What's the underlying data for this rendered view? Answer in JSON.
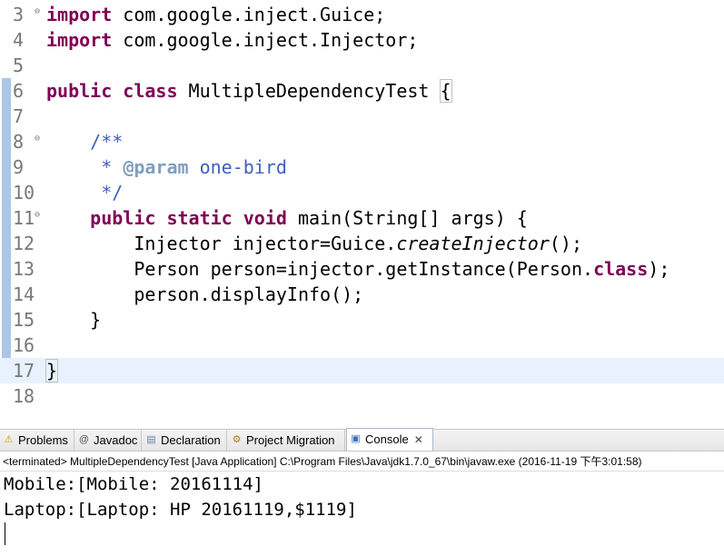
{
  "editor": {
    "lines": [
      {
        "num": "3",
        "fold": true,
        "parts": [
          {
            "t": "import",
            "c": "kw"
          },
          {
            "t": " com.google.inject.Guice;"
          }
        ]
      },
      {
        "num": "4",
        "parts": [
          {
            "t": "import",
            "c": "kw"
          },
          {
            "t": " com.google.inject.Injector;"
          }
        ]
      },
      {
        "num": "5",
        "parts": []
      },
      {
        "num": "6",
        "parts": [
          {
            "t": "public",
            "c": "kw"
          },
          {
            "t": " "
          },
          {
            "t": "class",
            "c": "kw"
          },
          {
            "t": " MultipleDependencyTest "
          },
          {
            "t": "{",
            "c": "brk"
          }
        ]
      },
      {
        "num": "7",
        "parts": []
      },
      {
        "num": "8",
        "fold": true,
        "parts": [
          {
            "t": "    "
          },
          {
            "t": "/**",
            "c": "jd"
          }
        ]
      },
      {
        "num": "9",
        "parts": [
          {
            "t": "     "
          },
          {
            "t": "* ",
            "c": "jd"
          },
          {
            "t": "@param",
            "c": "jdtag"
          },
          {
            "t": " one-bird",
            "c": "jd"
          }
        ]
      },
      {
        "num": "10",
        "parts": [
          {
            "t": "     "
          },
          {
            "t": "*/",
            "c": "jd"
          }
        ]
      },
      {
        "num": "11",
        "fold": true,
        "parts": [
          {
            "t": "    "
          },
          {
            "t": "public",
            "c": "kw"
          },
          {
            "t": " "
          },
          {
            "t": "static",
            "c": "kw"
          },
          {
            "t": " "
          },
          {
            "t": "void",
            "c": "kw"
          },
          {
            "t": " main(String[] args) {"
          }
        ]
      },
      {
        "num": "12",
        "parts": [
          {
            "t": "        Injector injector=Guice."
          },
          {
            "t": "createInjector",
            "c": "it"
          },
          {
            "t": "();"
          }
        ]
      },
      {
        "num": "13",
        "parts": [
          {
            "t": "        Person person=injector.getInstance(Person."
          },
          {
            "t": "class",
            "c": "kw"
          },
          {
            "t": ");"
          }
        ]
      },
      {
        "num": "14",
        "parts": [
          {
            "t": "        person.displayInfo();"
          }
        ]
      },
      {
        "num": "15",
        "parts": [
          {
            "t": "    }"
          }
        ]
      },
      {
        "num": "16",
        "parts": []
      },
      {
        "num": "17",
        "current": true,
        "parts": [
          {
            "t": "}",
            "c": "brk"
          }
        ]
      },
      {
        "num": "18",
        "parts": []
      }
    ],
    "hscroll_arrow": "‹"
  },
  "tabs": [
    {
      "label": "Problems",
      "icon": "problems-icon",
      "glyph": "⚠",
      "color": "#c8a000"
    },
    {
      "label": "Javadoc",
      "icon": "javadoc-icon",
      "glyph": "@",
      "color": "#555555"
    },
    {
      "label": "Declaration",
      "icon": "declaration-icon",
      "glyph": "▤",
      "color": "#6a7fa8"
    },
    {
      "label": "Project Migration",
      "icon": "project-migration-icon",
      "glyph": "⚙",
      "color": "#b07a2a"
    },
    {
      "label": "Console",
      "icon": "console-icon",
      "glyph": "▣",
      "color": "#3d6fb6",
      "active": true,
      "close": "✕"
    }
  ],
  "console": {
    "header": "<terminated> MultipleDependencyTest [Java Application] C:\\Program Files\\Java\\jdk1.7.0_67\\bin\\javaw.exe (2016-11-19 下午3:01:58)",
    "output": [
      "Mobile:[Mobile: 20161114]",
      "Laptop:[Laptop: HP 20161119,$1119]"
    ]
  }
}
